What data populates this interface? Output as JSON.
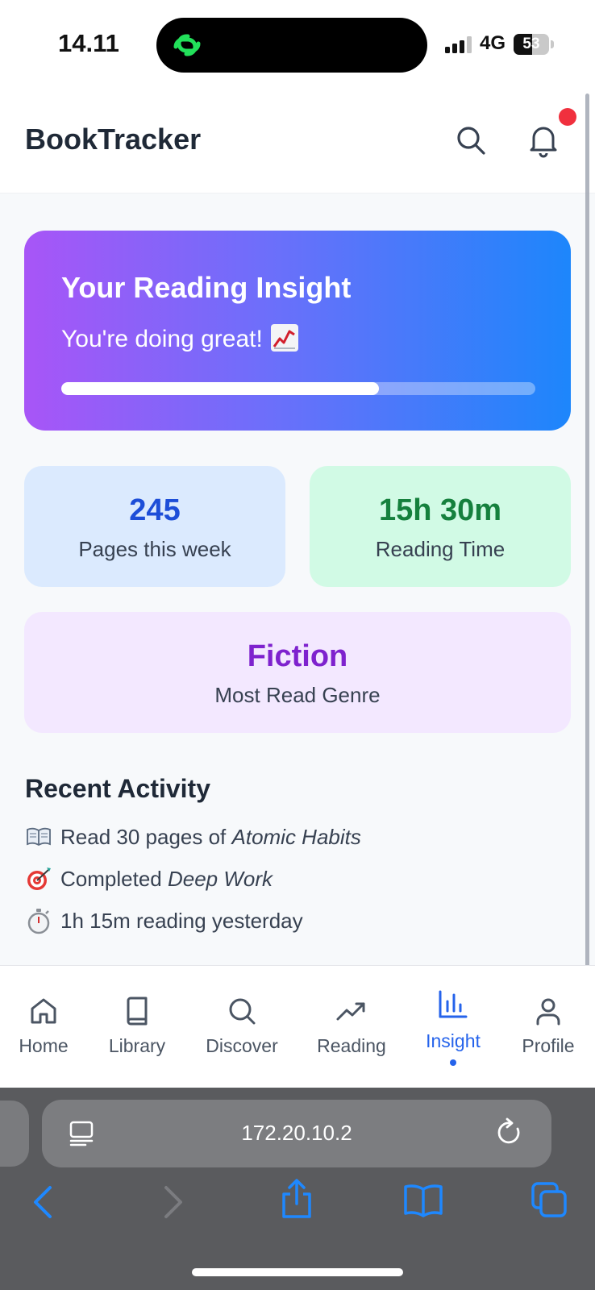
{
  "status_bar": {
    "time": "14.11",
    "network": "4G",
    "battery": "53",
    "battery_level": 0.53
  },
  "header": {
    "title": "BookTracker",
    "icons": [
      "search-icon",
      "bell-icon"
    ],
    "has_notification": true
  },
  "insight": {
    "title": "Your Reading Insight",
    "subtitle": "You're doing great!",
    "subtitle_emoji": "chart-increasing-emoji",
    "progress_percent": 67
  },
  "stats": {
    "pages": {
      "value": "245",
      "label": "Pages this week"
    },
    "time": {
      "value": "15h 30m",
      "label": "Reading Time"
    },
    "genre": {
      "value": "Fiction",
      "label": "Most Read Genre"
    }
  },
  "activity": {
    "title": "Recent Activity",
    "items": [
      {
        "icon": "book-icon",
        "text": "Read 30 pages of ",
        "emphasis": "Atomic Habits"
      },
      {
        "icon": "target-icon",
        "text": "Completed ",
        "emphasis": "Deep Work"
      },
      {
        "icon": "stopwatch-icon",
        "text": "1h 15m reading yesterday",
        "emphasis": ""
      }
    ]
  },
  "nav": {
    "items": [
      {
        "label": "Home",
        "icon": "home-icon"
      },
      {
        "label": "Library",
        "icon": "book-icon"
      },
      {
        "label": "Discover",
        "icon": "search-icon"
      },
      {
        "label": "Reading",
        "icon": "trending-up-icon"
      },
      {
        "label": "Insight",
        "icon": "bar-chart-icon"
      },
      {
        "label": "Profile",
        "icon": "user-icon"
      }
    ],
    "active": "Insight"
  },
  "browser": {
    "url": "172.20.10.2",
    "toolbar": [
      "back-icon",
      "forward-icon",
      "share-icon",
      "bookmarks-icon",
      "tabs-icon"
    ]
  },
  "colors": {
    "accent": "#2563eb",
    "gradient_start": "#a855f7",
    "gradient_end": "#1d86fb",
    "pages_bg": "#dbeafe",
    "time_bg": "#d1fae5",
    "genre_bg": "#f3e8ff"
  }
}
